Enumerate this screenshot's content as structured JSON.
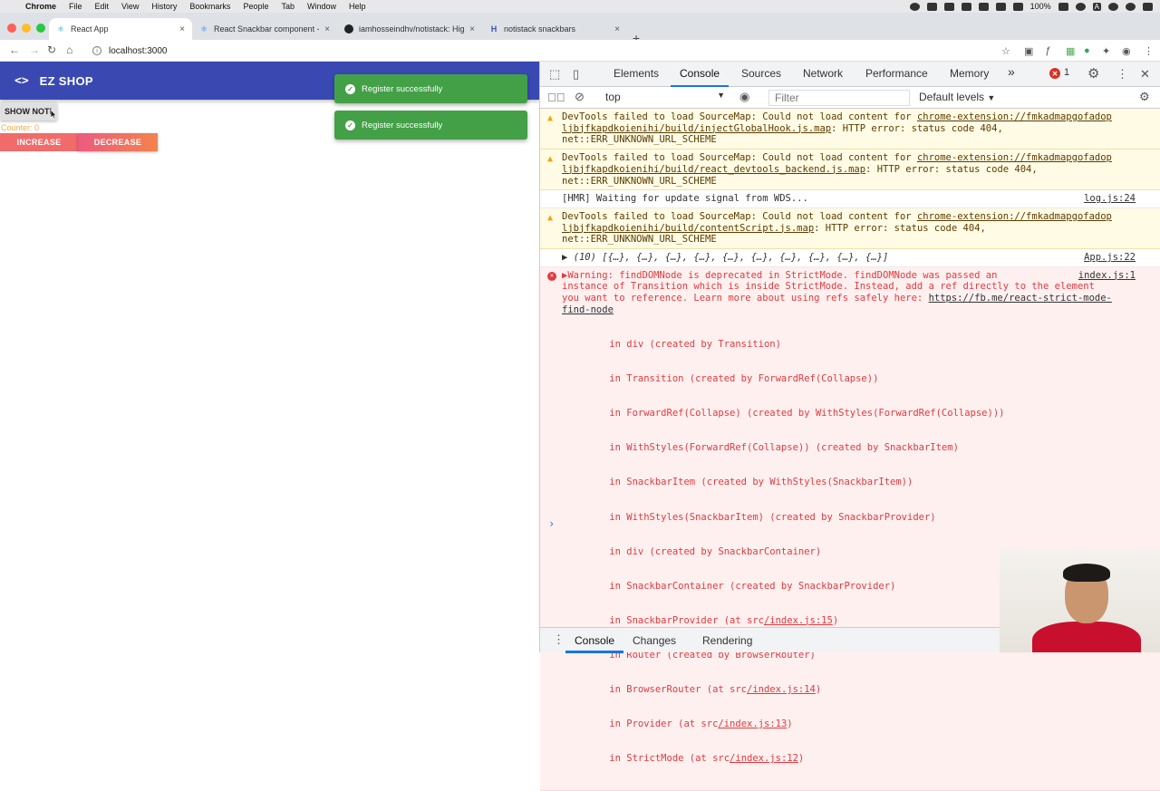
{
  "menubar": {
    "app": "Chrome",
    "items": [
      "File",
      "Edit",
      "View",
      "History",
      "Bookmarks",
      "People",
      "Tab",
      "Window",
      "Help"
    ],
    "battery": "100%",
    "letter": "A"
  },
  "tabs": [
    {
      "title": "React App",
      "icon": "react-icon"
    },
    {
      "title": "React Snackbar component - ",
      "icon": "react-snackbar-icon"
    },
    {
      "title": "iamhosseindhv/notistack: High",
      "icon": "github-icon"
    },
    {
      "title": "notistack snackbars",
      "icon": "notistack-icon"
    }
  ],
  "address": {
    "url": "localhost:3000"
  },
  "app": {
    "brand": "EZ SHOP",
    "code_icon": "<>",
    "show_button": "SHOW NOTI",
    "counter": "Counter: 0",
    "increase": "INCREASE",
    "decrease": "DECREASE",
    "snackbars": [
      "Register successfully",
      "Register successfully"
    ],
    "colors": {
      "appbar": "#3a49b2",
      "snackbar": "#43a047",
      "increase": "#f16b6b"
    }
  },
  "devtools": {
    "tabs": [
      "Elements",
      "Console",
      "Sources",
      "Network",
      "Performance",
      "Memory"
    ],
    "more": "»",
    "error_count": "1",
    "context": "top",
    "filter_placeholder": "Filter",
    "levels": "Default levels",
    "messages": {
      "w1": {
        "pre": "DevTools failed to load SourceMap: Could not load content for ",
        "link1": "chrome-extension://fmkadmapgofadop",
        "link2": "ljbjfkapdkoienihi/build/injectGlobalHook.js.map",
        "post": ": HTTP error: status code 404,",
        "line3": "net::ERR_UNKNOWN_URL_SCHEME"
      },
      "w2": {
        "pre": "DevTools failed to load SourceMap: Could not load content for ",
        "link1": "chrome-extension://fmkadmapgofadop",
        "link2": "ljbjfkapdkoienihi/build/react_devtools_backend.js.map",
        "post": ": HTTP error: status code 404,",
        "line3": "net::ERR_UNKNOWN_URL_SCHEME"
      },
      "info": {
        "text": "[HMR] Waiting for update signal from WDS...",
        "src": "log.js:24"
      },
      "w3": {
        "pre": "DevTools failed to load SourceMap: Could not load content for ",
        "link1": "chrome-extension://fmkadmapgofadop",
        "link2": "ljbjfkapdkoienihi/build/contentScript.js.map",
        "post": ": HTTP error: status code 404,",
        "line3": "net::ERR_UNKNOWN_URL_SCHEME"
      },
      "arr": {
        "text": "▶ (10) [{…}, {…}, {…}, {…}, {…}, {…}, {…}, {…}, {…}, {…}]",
        "src": "App.js:22"
      },
      "err": {
        "src": "index.js:1",
        "line1": "▶Warning: findDOMNode is deprecated in StrictMode. findDOMNode was passed an",
        "line2": "instance of Transition which is inside StrictMode. Instead, add a ref directly to the element",
        "line3pre": "you want to reference. Learn more about using refs safely here: ",
        "link1": "https://fb.me/react-strict-mode-",
        "link2": "find-node",
        "stack": [
          "    in div (created by Transition)",
          "    in Transition (created by ForwardRef(Collapse))",
          "    in ForwardRef(Collapse) (created by WithStyles(ForwardRef(Collapse)))",
          "    in WithStyles(ForwardRef(Collapse)) (created by SnackbarItem)",
          "    in SnackbarItem (created by WithStyles(SnackbarItem))",
          "    in WithStyles(SnackbarItem) (created by SnackbarProvider)",
          "    in div (created by SnackbarContainer)",
          "    in SnackbarContainer (created by SnackbarProvider)"
        ],
        "stack_src": [
          {
            "pre": "    in SnackbarProvider (at src",
            "link": "/index.js:15",
            "post": ")"
          },
          {
            "pre": "    in Router (created by BrowserRouter)",
            "link": "",
            "post": ""
          },
          {
            "pre": "    in BrowserRouter (at src",
            "link": "/index.js:14",
            "post": ")"
          },
          {
            "pre": "    in Provider (at src",
            "link": "/index.js:13",
            "post": ")"
          },
          {
            "pre": "    in StrictMode (at src",
            "link": "/index.js:12",
            "post": ")"
          }
        ]
      }
    },
    "drawer_tabs": [
      "Console",
      "Changes",
      "Rendering"
    ]
  }
}
